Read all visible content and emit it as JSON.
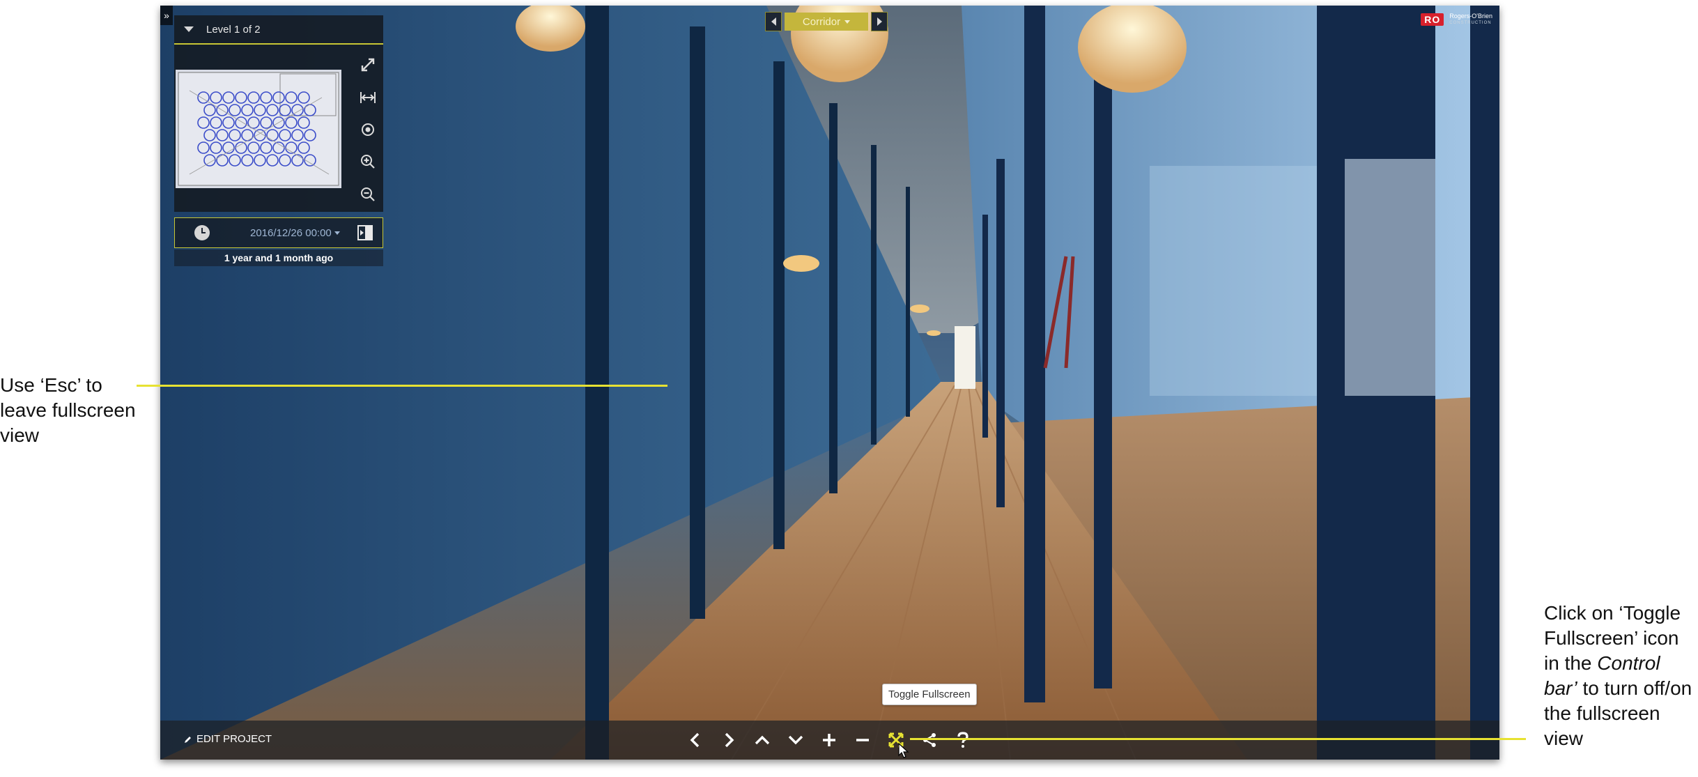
{
  "floor_panel": {
    "level_label": "Level 1 of 2",
    "tools": [
      "expand-icon",
      "fit-width-icon",
      "locate-icon",
      "zoom-in-icon",
      "zoom-out-icon"
    ]
  },
  "date_panel": {
    "date_value": "2016/12/26 00:00",
    "relative_time": "1 year and 1 month ago"
  },
  "location_selector": {
    "current": "Corridor"
  },
  "brand": {
    "mark": "RO",
    "name": "Rogers-O'Brien",
    "tagline": "CONSTRUCTION"
  },
  "control_bar": {
    "edit_label": "EDIT PROJECT",
    "controls": [
      "prev-icon",
      "next-icon",
      "up-icon",
      "down-icon",
      "zoom-in-icon",
      "zoom-out-icon",
      "fullscreen-icon",
      "share-icon",
      "help-icon"
    ],
    "tooltip": "Toggle Fullscreen"
  },
  "annotations": {
    "left_text": "Use ‘Esc’ to leave fullscreen view",
    "right_text_parts": [
      "Click on ‘Toggle Fullscreen’ icon in the ",
      "Control bar’",
      " to turn off/on the fullscreen view"
    ]
  },
  "colors": {
    "accent_yellow": "#e7e232",
    "selector_gold": "#c4b63c",
    "brand_red": "#d8202c"
  }
}
